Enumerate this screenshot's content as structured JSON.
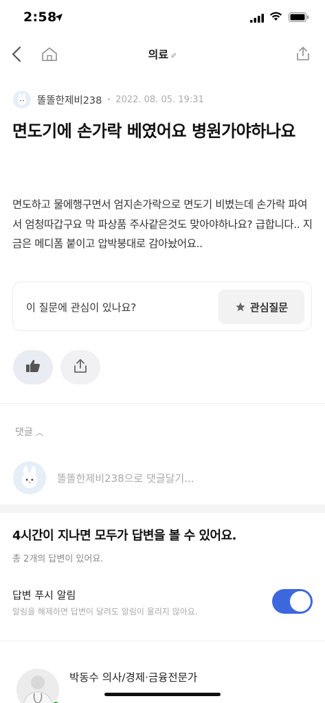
{
  "status": {
    "time": "2:58"
  },
  "nav": {
    "title": "의료"
  },
  "author": {
    "name": "똘똘한제비238",
    "date": "2022. 08. 05. 19:31"
  },
  "question": {
    "title": "면도기에 손가락 베였어요 병원가야하나요",
    "body": "면도하고 물에행구면서 엄지손가락으로 면도기 비볐는데 손가락 파여서 엄청따갑구요 막 파상품 주사같은것도 맞아야하나요? 급합니다.. 지금은 메디폼 붙이고 압박붕대로 감아놨어요.."
  },
  "interest": {
    "text": "이 질문에 관심이 있나요?",
    "button_label": "관심질문"
  },
  "comments": {
    "toggle_label": "댓글",
    "placeholder": "똘똘한제비238으로 댓글달기..."
  },
  "answers": {
    "title": "4시간이 지나면 모두가 답변을 볼 수 있어요.",
    "count_text": "총 2개의 답변이 있어요.",
    "push_label": "답변 푸시 알림",
    "push_desc": "알림을 해제하면 답변이 달려도 알림이 울리지 않아요.",
    "push_enabled": true
  },
  "expert": {
    "name": "박동수 의사/경제·금융전문가"
  },
  "colors": {
    "toggle_on": "#3d67dd",
    "badge": "#3cb64d"
  },
  "icons": [
    "location-arrow-icon",
    "signal-icon",
    "wifi-icon",
    "battery-icon",
    "back-chevron-icon",
    "home-icon",
    "share-icon",
    "star-icon",
    "thumbs-up-icon",
    "avatar-bunny-icon"
  ]
}
